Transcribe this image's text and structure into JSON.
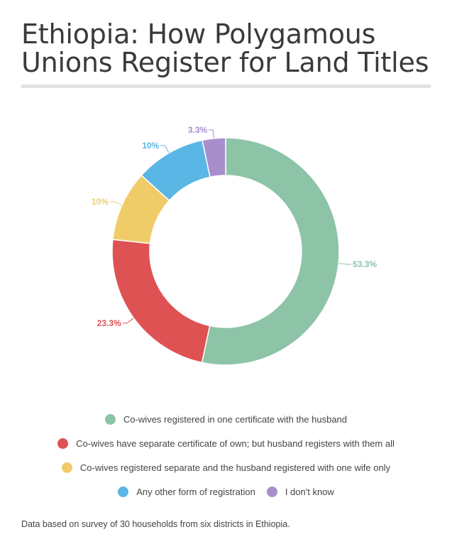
{
  "title": "Ethiopia: How Polygamous Unions Register for Land Titles",
  "footnote": "Data based on survey of 30 households from six districts in Ethiopia.",
  "chart_data": {
    "type": "pie",
    "title": "Ethiopia: How Polygamous Unions Register for Land Titles",
    "donut": true,
    "legend_position": "bottom",
    "series": [
      {
        "name": "Co-wives registered in one certificate with the husband",
        "value": 53.3,
        "label": "53.3%",
        "color": "#8dc3a7"
      },
      {
        "name": "Co-wives have separate certificate of own; but husband registers with them all",
        "value": 23.3,
        "label": "23.3%",
        "color": "#de5253"
      },
      {
        "name": "Co-wives registered separate and the husband registered with one wife only",
        "value": 10,
        "label": "10%",
        "color": "#f0cc69"
      },
      {
        "name": "Any other form of registration",
        "value": 10,
        "label": "10%",
        "color": "#5ab6e5"
      },
      {
        "name": "I don't know",
        "value": 3.3,
        "label": "3.3%",
        "color": "#a88fcc"
      }
    ]
  }
}
